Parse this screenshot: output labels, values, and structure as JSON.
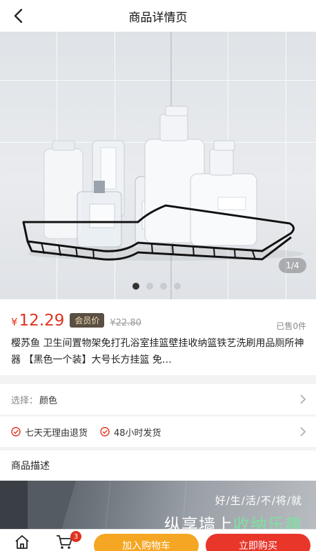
{
  "header": {
    "title": "商品详情页",
    "back_icon": "back-arrow-icon"
  },
  "gallery": {
    "counter": "1/4",
    "current": 1,
    "total": 4
  },
  "product": {
    "currency": "¥",
    "price": "12.29",
    "member_tag": "会员价",
    "original_price": "¥22.80",
    "sold": "已售0件",
    "name": "樱苏鱼 卫生间置物架免打孔浴室挂篮壁挂收纳篮铁艺洗刷用品厕所神器 【黑色一个装】大号长方挂篮 免…"
  },
  "selection": {
    "label": "选择：",
    "value": "颜色"
  },
  "services": [
    {
      "label": "七天无理由退货",
      "icon": "check-circle-icon"
    },
    {
      "label": "48小时发货",
      "icon": "check-circle-icon"
    }
  ],
  "description": {
    "title": "商品描述",
    "tagline": "好/生/活/不/将/就",
    "headline_a": "纵享墙上",
    "headline_b": "收纳乐趣"
  },
  "bottom": {
    "cart_count": "3",
    "add_to_cart": "加入购物车",
    "buy_now": "立即购买"
  },
  "colors": {
    "accent": "#e0321f",
    "orange": "#f5a623",
    "member_tag_bg": "#5a4f43"
  }
}
